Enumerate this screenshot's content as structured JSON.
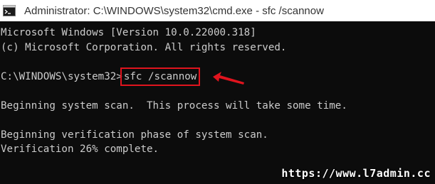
{
  "window": {
    "title": "Administrator: C:\\WINDOWS\\system32\\cmd.exe - sfc  /scannow",
    "icon": "cmd-icon"
  },
  "console": {
    "line1": "Microsoft Windows [Version 10.0.22000.318]",
    "line2": "(c) Microsoft Corporation. All rights reserved.",
    "prompt": "C:\\WINDOWS\\system32>",
    "command": "sfc /scannow",
    "line4": "Beginning system scan.  This process will take some time.",
    "line5": "Beginning verification phase of system scan.",
    "line6": "Verification 26% complete."
  },
  "annotation": {
    "arrow_icon": "red-arrow-icon",
    "highlight_color": "#e0141e"
  },
  "watermark": {
    "text": "https://www.l7admin.cc"
  },
  "colors": {
    "console_bg": "#0c0c0c",
    "console_fg": "#cccccc",
    "titlebar_bg": "#ffffff"
  }
}
